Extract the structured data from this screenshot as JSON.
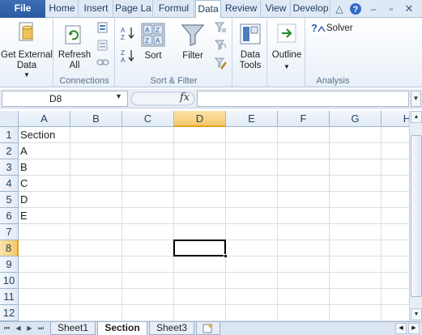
{
  "ribbon_tabs": [
    "File",
    "Home",
    "Insert",
    "Page La",
    "Formul",
    "Data",
    "Review",
    "View",
    "Develop"
  ],
  "active_tab": "Data",
  "ribbon": {
    "get_external_data": "Get External\nData",
    "refresh_all": "Refresh\nAll",
    "connections_label": "Connections",
    "sort_label": "Sort",
    "filter_label": "Filter",
    "sort_filter_group": "Sort & Filter",
    "data_tools": "Data\nTools",
    "outline": "Outline",
    "solver": "Solver",
    "analysis_group": "Analysis"
  },
  "formula_bar": {
    "name_box": "D8",
    "fx": "fx",
    "formula": ""
  },
  "columns": [
    "A",
    "B",
    "C",
    "D",
    "E",
    "F",
    "G",
    "H"
  ],
  "rows": [
    "1",
    "2",
    "3",
    "4",
    "5",
    "6",
    "7",
    "8",
    "9",
    "10",
    "11",
    "12"
  ],
  "selected_column": "D",
  "selected_row": "8",
  "cells": {
    "A1": "Section",
    "A2": "A",
    "A3": "B",
    "A4": "C",
    "A5": "D",
    "A6": "E"
  },
  "sheets": [
    "Sheet1",
    "Section",
    "Sheet3"
  ],
  "active_sheet": "Section",
  "colors": {
    "accent": "#2b5797",
    "selection_header": "#f6c86a"
  }
}
